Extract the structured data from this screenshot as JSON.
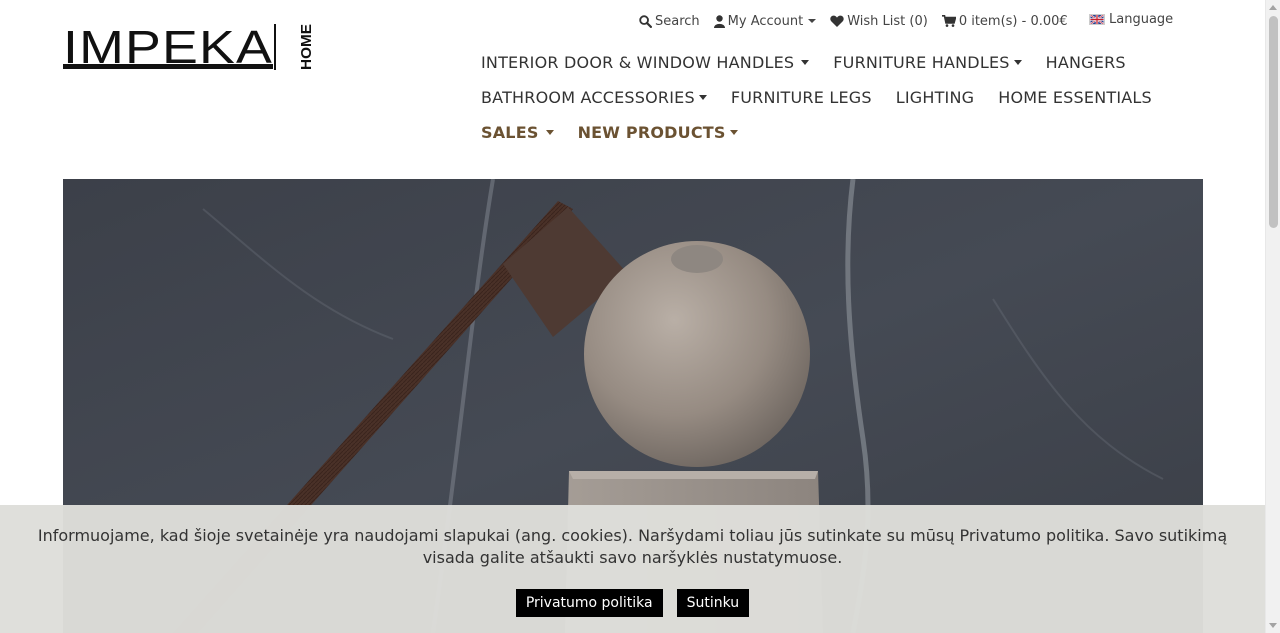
{
  "brand": {
    "logo_main": "IMPEKA",
    "logo_side": "HOME"
  },
  "topbar": {
    "search": "Search",
    "account": "My Account",
    "wishlist": "Wish List (0)",
    "cart": "0 item(s) - 0.00€",
    "language": "Language"
  },
  "nav": {
    "row1": [
      "INTERIOR DOOR & WINDOW HANDLES",
      "FURNITURE HANDLES",
      "HANGERS"
    ],
    "row2": [
      "BATHROOM ACCESSORIES",
      "FURNITURE LEGS",
      "LIGHTING",
      "HOME ESSENTIALS"
    ],
    "row3": [
      "SALES",
      "NEW PRODUCTS"
    ]
  },
  "cookie": {
    "text": "Informuojame, kad šioje svetainėje yra naudojami slapukai (ang. cookies). Naršydami toliau jūs sutinkate su mūsų Privatumo politika. Savo sutikimą visada galite atšaukti savo naršyklės nustatymuose.",
    "privacy_button": "Privatumo politika",
    "agree_button": "Sutinku"
  },
  "colors": {
    "accent": "#6b5232",
    "cookie_bg": "#dededa",
    "button_bg": "#000000"
  }
}
